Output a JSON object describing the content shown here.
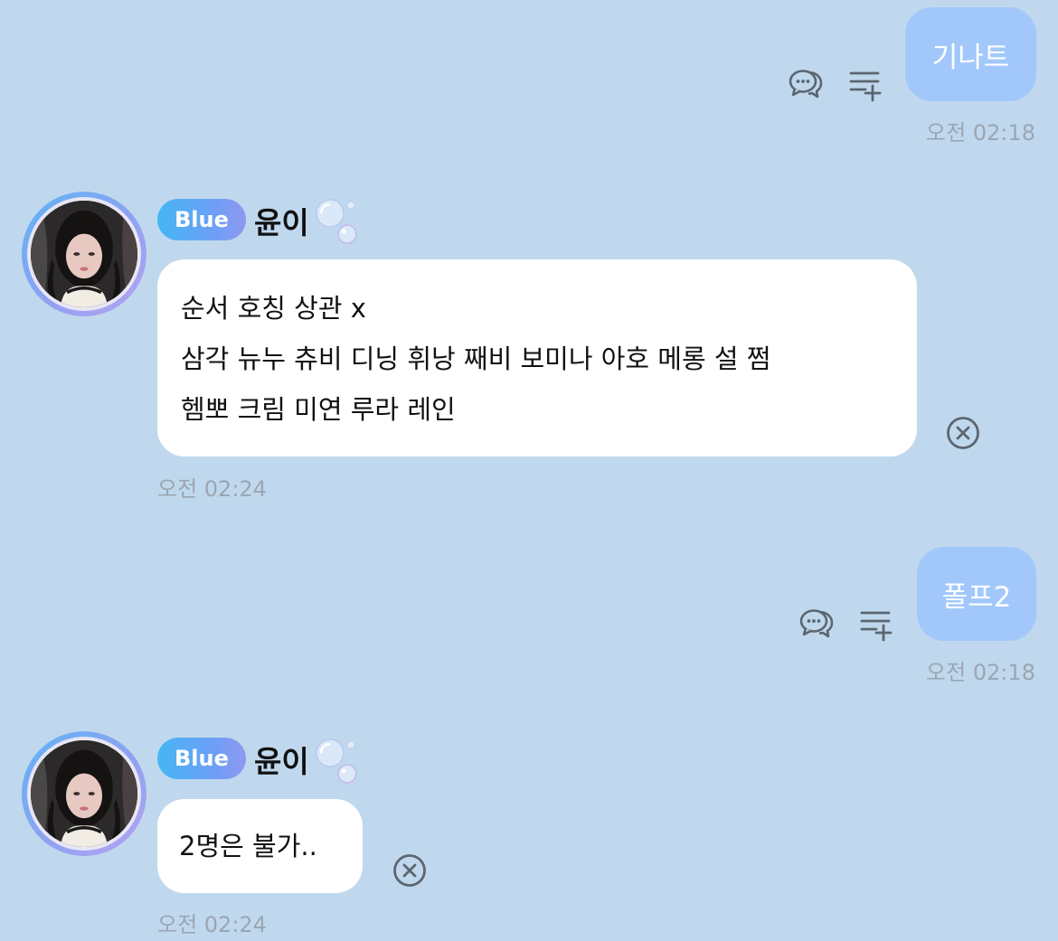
{
  "messages": [
    {
      "direction": "outgoing",
      "text": "기나트",
      "time": "오전 02:18",
      "actions": [
        "reply-bubble-icon",
        "add-to-list-icon"
      ]
    },
    {
      "direction": "incoming",
      "badge": "Blue",
      "sender": "윤이",
      "lines": [
        "순서 호칭 상관 x",
        "삼각 뉴누 츄비 디닝 휘낭 째비 보미나 아호 메롱 설 쩜",
        "헴뽀 크림 미연 루라 레인"
      ],
      "time": "오전 02:24",
      "actions": [
        "close-circle-icon"
      ]
    },
    {
      "direction": "outgoing",
      "text": "폴프2",
      "time": "오전 02:18",
      "actions": [
        "reply-bubble-icon",
        "add-to-list-icon"
      ]
    },
    {
      "direction": "incoming",
      "badge": "Blue",
      "sender": "윤이",
      "lines": [
        "2명은 불가.."
      ],
      "time": "오전 02:24",
      "actions": [
        "close-circle-icon"
      ]
    }
  ],
  "colors": {
    "background": "#c0d8ee",
    "outgoing_bubble": "#a2c8fb",
    "incoming_bubble": "#ffffff",
    "timestamp": "#9aa6b2",
    "badge_gradient_start": "#45b6f4",
    "badge_gradient_end": "#8f98f0",
    "icon": "#5c6670"
  }
}
